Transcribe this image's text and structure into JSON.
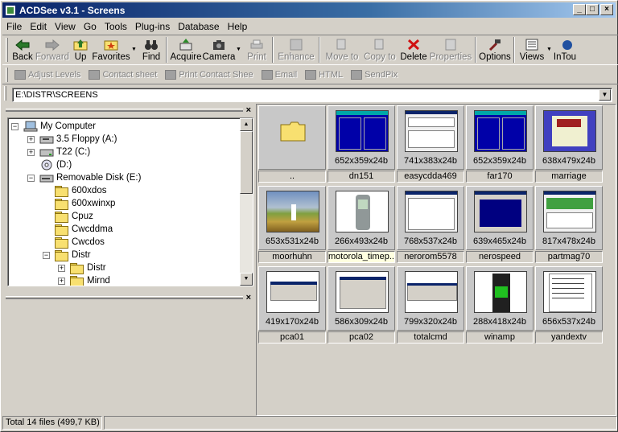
{
  "window": {
    "title": "ACDSee v3.1 - Screens"
  },
  "menu": [
    "File",
    "Edit",
    "View",
    "Go",
    "Tools",
    "Plug-ins",
    "Database",
    "Help"
  ],
  "toolbar": {
    "back": "Back",
    "forward": "Forward",
    "up": "Up",
    "favorites": "Favorites",
    "find": "Find",
    "acquire": "Acquire",
    "camera": "Camera",
    "print": "Print",
    "enhance": "Enhance",
    "move_to": "Move to",
    "copy_to": "Copy to",
    "delete": "Delete",
    "properties": "Properties",
    "options": "Options",
    "views": "Views",
    "intouch": "InTou"
  },
  "toolbar2": {
    "adjust_levels": "Adjust Levels",
    "contact_sheet": "Contact sheet",
    "print_contact": "Print Contact Shee",
    "email": "Email",
    "html": "HTML",
    "sendpix": "SendPix"
  },
  "address": {
    "path": "E:\\DISTR\\SCREENS"
  },
  "tree": {
    "my_computer": "My Computer",
    "floppy": "3.5 Floppy (A:)",
    "t22": "T22 (C:)",
    "d": "(D:)",
    "removable": "Removable Disk (E:)",
    "f1": "600xdos",
    "f2": "600xwinxp",
    "f3": "Cpuz",
    "f4": "Cwcddma",
    "f5": "Cwcdos",
    "f6": "Distr",
    "f7": "Distr",
    "f8": "Mirnd"
  },
  "files": [
    {
      "name": "..",
      "dims": ""
    },
    {
      "name": "dn151",
      "dims": "652x359x24b"
    },
    {
      "name": "easycdda469",
      "dims": "741x383x24b"
    },
    {
      "name": "far170",
      "dims": "652x359x24b"
    },
    {
      "name": "marriage",
      "dims": "638x479x24b"
    },
    {
      "name": "moorhuhn",
      "dims": "653x531x24b"
    },
    {
      "name": "motorola_timep...",
      "dims": "266x493x24b"
    },
    {
      "name": "nerorom5578",
      "dims": "768x537x24b"
    },
    {
      "name": "nerospeed",
      "dims": "639x465x24b"
    },
    {
      "name": "partmag70",
      "dims": "817x478x24b"
    },
    {
      "name": "pca01",
      "dims": "419x170x24b"
    },
    {
      "name": "pca02",
      "dims": "586x309x24b"
    },
    {
      "name": "totalcmd",
      "dims": "799x320x24b"
    },
    {
      "name": "winamp",
      "dims": "288x418x24b"
    },
    {
      "name": "yandextv",
      "dims": "656x537x24b"
    }
  ],
  "status": {
    "total": "Total 14 files (499,7 KB)"
  },
  "colors": {
    "title_start": "#0a246a",
    "title_end": "#a6caf0",
    "face": "#d4d0c8"
  }
}
